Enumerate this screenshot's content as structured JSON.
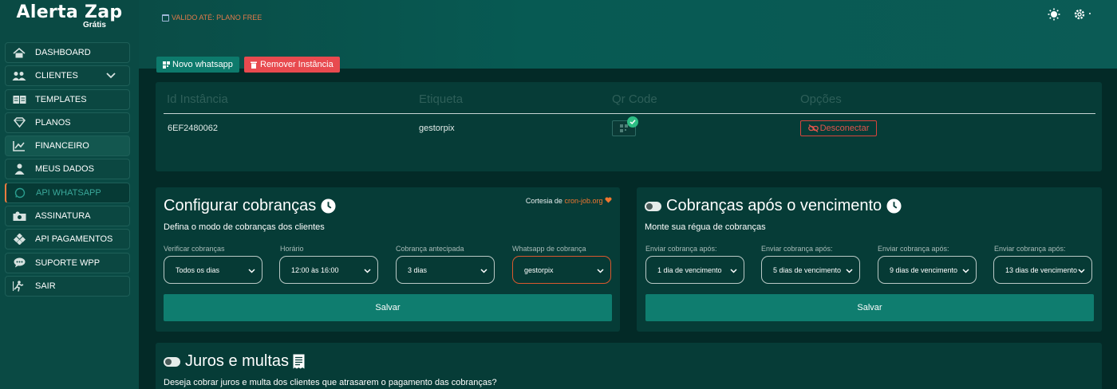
{
  "brand": {
    "title": "Alerta Zap",
    "subtitle": "Grátis"
  },
  "sidebar": {
    "items": [
      {
        "label": "DASHBOARD",
        "icon": "home-icon"
      },
      {
        "label": "CLIENTES",
        "icon": "users-icon"
      },
      {
        "label": "TEMPLATES",
        "icon": "book-open-icon"
      },
      {
        "label": "PLANOS",
        "icon": "gem-icon"
      },
      {
        "label": "FINANCEIRO",
        "icon": "chart-line-icon"
      },
      {
        "label": "MEUS DADOS",
        "icon": "user-tie-icon"
      },
      {
        "label": "API WHATSAPP",
        "icon": "whatsapp-icon"
      },
      {
        "label": "ASSINATURA",
        "icon": "money-icon"
      },
      {
        "label": "API PAGAMENTOS",
        "icon": "diamonds-icon"
      },
      {
        "label": "SUPORTE WPP",
        "icon": "chat-icon"
      },
      {
        "label": "SAIR",
        "icon": "exit-icon"
      }
    ]
  },
  "header": {
    "plan_note": "VALIDO ATÉ: PLANO FREE",
    "icons": [
      "sun-icon",
      "gear-icon"
    ],
    "new_button": "Novo whatsapp",
    "remove_button": "Remover Instância"
  },
  "instances": {
    "columns": [
      "Id Instância",
      "Etiqueta",
      "Qr Code",
      "Opções"
    ],
    "rows": [
      {
        "id": "6EF2480062",
        "label": "gestorpix",
        "disconnect": "Desconectar"
      }
    ]
  },
  "config": {
    "title": "Configurar cobranças",
    "subtitle": "Defina o modo de cobranças dos clientes",
    "courtesy_prefix": "Cortesia de",
    "courtesy_link": "cron-job.org",
    "fields": [
      {
        "label": "Verificar cobranças",
        "value": "Todos os dias"
      },
      {
        "label": "Horário",
        "value": "12:00 às 16:00"
      },
      {
        "label": "Cobrança antecipada",
        "value": "3 dias"
      },
      {
        "label": "Whatsapp de cobrança",
        "value": "gestorpix"
      }
    ],
    "save": "Salvar"
  },
  "overdue": {
    "title": "Cobranças após o vencimento",
    "subtitle": "Monte sua régua de cobranças",
    "fields": [
      {
        "label": "Enviar cobrança após:",
        "value": "1 dia de vencimento"
      },
      {
        "label": "Enviar cobrança após:",
        "value": "5 dias de vencimento"
      },
      {
        "label": "Enviar cobrança após:",
        "value": "9 dias de vencimento"
      },
      {
        "label": "Enviar cobrança após:",
        "value": "13 dias de vencimento"
      }
    ],
    "save": "Salvar"
  },
  "interest": {
    "title": "Juros e multas",
    "subtitle": "Deseja cobrar juros e multa dos clientes que atrasarem o pagamento das cobranças?"
  },
  "colors": {
    "accent": "#0f7d6f",
    "danger": "#e84a4f",
    "highlight": "#f0762f"
  }
}
